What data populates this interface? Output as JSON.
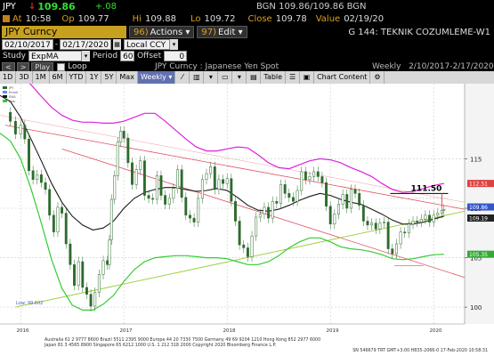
{
  "header": {
    "ticker": "JPY",
    "arrow": "↓",
    "last": "109.86",
    "change": "+.08",
    "bid_ask": "BGN 109.86/109.86 BGN",
    "at_label": "At",
    "at_value": "10:58",
    "op_label": "Op",
    "op_value": "109.77",
    "hi_label": "Hi",
    "hi_value": "109.88",
    "lo_label": "Lo",
    "lo_value": "109.72",
    "close_label": "Close",
    "close_value": "109.78",
    "value_label": "Value",
    "value_value": "02/19/20"
  },
  "function_bar": {
    "security": "JPY Curncy",
    "actions_num": "96)",
    "actions_label": "Actions",
    "edit_num": "97)",
    "edit_label": "Edit",
    "page_title": "G 144: TEKNIK COZUMLEME-W1"
  },
  "dates": {
    "start": "02/10/2017",
    "end": "02/17/2020",
    "currency": "Local CCY"
  },
  "study": {
    "label": "Study",
    "study_value": "ExpMA",
    "period_label": "Period",
    "period_value": "60",
    "offset_label": "Offset",
    "offset_value": "0"
  },
  "play": {
    "play_label": "Play",
    "loop_label": "Loop",
    "chart_name": "JPY Curncy : Japanese Yen Spot",
    "period": "Weekly",
    "range": "2/10/2017-2/17/2020"
  },
  "toolbar": {
    "tabs": [
      "1D",
      "3D",
      "1M",
      "6M",
      "YTD",
      "1Y",
      "5Y",
      "Max"
    ],
    "frequency": "Weekly",
    "table_label": "Table",
    "content_label": "Chart Content"
  },
  "chart_data": {
    "type": "line",
    "title": "",
    "x_ticks": [
      "2016",
      "2017",
      "2018",
      "2019",
      "2020"
    ],
    "y_ticks": [
      100,
      105,
      110,
      115
    ],
    "ylim": [
      98.3,
      122.6
    ],
    "xlim": [
      2015.8,
      2020.3
    ],
    "legend_items": [
      "JPY",
      "EmaU",
      "EMA",
      "Low"
    ],
    "price_tags": {
      "top": "112.51",
      "last": "109.86",
      "ema": "109.19",
      "lower": "105.35"
    },
    "annotations": {
      "target": "111.50",
      "low_label": "Low: 99.602"
    },
    "footer": [
      "Australia 61 2 9777 8600  Brazil 5511 2395 9000  Europe 44 20 7330 7500  Germany 49 69 9204 1210  Hong Kong 852 2977 6000",
      "Japan 81 3 4565 8900          Singapore 65 6212 1000          U.S. 1 212 318 2000          Copyright 2020 Bloomberg Finance L.P.",
      "SN 546679 TRT  GMT+3:00 H835-2066-0 17-Feb-2020 10:58:31"
    ],
    "price": [
      [
        2015.85,
        119.7
      ],
      [
        2015.9,
        118.8
      ],
      [
        2015.95,
        117.5
      ],
      [
        2016.0,
        118.4
      ],
      [
        2016.04,
        117.0
      ],
      [
        2016.08,
        113.8
      ],
      [
        2016.12,
        112.9
      ],
      [
        2016.16,
        113.4
      ],
      [
        2016.2,
        112.6
      ],
      [
        2016.24,
        111.9
      ],
      [
        2016.28,
        109.3
      ],
      [
        2016.32,
        107.6
      ],
      [
        2016.36,
        110.1
      ],
      [
        2016.4,
        109.5
      ],
      [
        2016.44,
        106.4
      ],
      [
        2016.48,
        104.3
      ],
      [
        2016.52,
        102.2
      ],
      [
        2016.56,
        104.6
      ],
      [
        2016.6,
        102.0
      ],
      [
        2016.64,
        101.3
      ],
      [
        2016.68,
        100.1
      ],
      [
        2016.72,
        101.5
      ],
      [
        2016.76,
        103.3
      ],
      [
        2016.8,
        104.7
      ],
      [
        2016.84,
        104.3
      ],
      [
        2016.86,
        106.8
      ],
      [
        2016.88,
        110.9
      ],
      [
        2016.91,
        113.3
      ],
      [
        2016.94,
        116.7
      ],
      [
        2016.97,
        117.8
      ],
      [
        2017.0,
        117.1
      ],
      [
        2017.04,
        114.6
      ],
      [
        2017.08,
        112.4
      ],
      [
        2017.12,
        113.9
      ],
      [
        2017.16,
        114.8
      ],
      [
        2017.2,
        111.3
      ],
      [
        2017.24,
        111.0
      ],
      [
        2017.28,
        110.9
      ],
      [
        2017.32,
        113.3
      ],
      [
        2017.36,
        111.3
      ],
      [
        2017.4,
        110.4
      ],
      [
        2017.44,
        111.0
      ],
      [
        2017.48,
        112.0
      ],
      [
        2017.52,
        113.9
      ],
      [
        2017.56,
        111.1
      ],
      [
        2017.6,
        109.3
      ],
      [
        2017.64,
        109.0
      ],
      [
        2017.68,
        108.6
      ],
      [
        2017.72,
        111.0
      ],
      [
        2017.76,
        112.9
      ],
      [
        2017.8,
        113.5
      ],
      [
        2017.84,
        114.2
      ],
      [
        2017.88,
        111.9
      ],
      [
        2017.92,
        112.9
      ],
      [
        2017.96,
        112.5
      ],
      [
        2018.0,
        113.0
      ],
      [
        2018.04,
        110.7
      ],
      [
        2018.08,
        108.7
      ],
      [
        2018.12,
        106.3
      ],
      [
        2018.16,
        106.0
      ],
      [
        2018.2,
        105.1
      ],
      [
        2018.24,
        107.2
      ],
      [
        2018.28,
        109.1
      ],
      [
        2018.32,
        109.4
      ],
      [
        2018.36,
        110.1
      ],
      [
        2018.4,
        109.0
      ],
      [
        2018.44,
        110.7
      ],
      [
        2018.48,
        110.5
      ],
      [
        2018.52,
        112.4
      ],
      [
        2018.56,
        111.5
      ],
      [
        2018.6,
        111.1
      ],
      [
        2018.64,
        110.7
      ],
      [
        2018.68,
        111.8
      ],
      [
        2018.72,
        113.7
      ],
      [
        2018.76,
        112.9
      ],
      [
        2018.8,
        113.2
      ],
      [
        2018.84,
        113.7
      ],
      [
        2018.88,
        113.2
      ],
      [
        2018.92,
        112.6
      ],
      [
        2018.96,
        110.2
      ],
      [
        2019.0,
        108.4
      ],
      [
        2019.04,
        109.4
      ],
      [
        2019.08,
        110.4
      ],
      [
        2019.12,
        111.4
      ],
      [
        2019.16,
        110.0
      ],
      [
        2019.2,
        111.9
      ],
      [
        2019.24,
        111.5
      ],
      [
        2019.28,
        110.3
      ],
      [
        2019.32,
        108.7
      ],
      [
        2019.36,
        108.3
      ],
      [
        2019.4,
        108.5
      ],
      [
        2019.44,
        107.9
      ],
      [
        2019.48,
        108.5
      ],
      [
        2019.52,
        108.6
      ],
      [
        2019.56,
        105.9
      ],
      [
        2019.6,
        105.4
      ],
      [
        2019.64,
        106.4
      ],
      [
        2019.68,
        107.6
      ],
      [
        2019.72,
        107.5
      ],
      [
        2019.76,
        108.4
      ],
      [
        2019.8,
        108.7
      ],
      [
        2019.84,
        108.6
      ],
      [
        2019.88,
        108.9
      ],
      [
        2019.92,
        109.3
      ],
      [
        2019.96,
        108.6
      ],
      [
        2020.0,
        109.3
      ],
      [
        2020.04,
        109.5
      ],
      [
        2020.08,
        109.8
      ],
      [
        2020.1,
        109.86
      ]
    ],
    "ema": [
      [
        2015.8,
        121.4
      ],
      [
        2015.9,
        120.8
      ],
      [
        2016.0,
        119.2
      ],
      [
        2016.1,
        117.0
      ],
      [
        2016.2,
        114.8
      ],
      [
        2016.3,
        112.5
      ],
      [
        2016.4,
        110.6
      ],
      [
        2016.5,
        109.2
      ],
      [
        2016.6,
        108.3
      ],
      [
        2016.7,
        107.8
      ],
      [
        2016.8,
        108.0
      ],
      [
        2016.9,
        108.7
      ],
      [
        2017.0,
        110.0
      ],
      [
        2017.1,
        111.0
      ],
      [
        2017.2,
        111.6
      ],
      [
        2017.3,
        111.9
      ],
      [
        2017.4,
        112.1
      ],
      [
        2017.5,
        112.1
      ],
      [
        2017.6,
        111.9
      ],
      [
        2017.7,
        111.7
      ],
      [
        2017.8,
        111.8
      ],
      [
        2017.9,
        112.0
      ],
      [
        2018.0,
        111.8
      ],
      [
        2018.1,
        111.1
      ],
      [
        2018.2,
        110.3
      ],
      [
        2018.3,
        109.8
      ],
      [
        2018.4,
        109.7
      ],
      [
        2018.5,
        109.9
      ],
      [
        2018.6,
        110.3
      ],
      [
        2018.7,
        110.8
      ],
      [
        2018.8,
        111.2
      ],
      [
        2018.9,
        111.5
      ],
      [
        2019.0,
        111.3
      ],
      [
        2019.1,
        110.9
      ],
      [
        2019.2,
        110.6
      ],
      [
        2019.3,
        110.4
      ],
      [
        2019.4,
        109.9
      ],
      [
        2019.5,
        109.4
      ],
      [
        2019.6,
        108.8
      ],
      [
        2019.7,
        108.4
      ],
      [
        2019.8,
        108.4
      ],
      [
        2019.9,
        108.6
      ],
      [
        2020.0,
        108.9
      ],
      [
        2020.1,
        109.19
      ]
    ],
    "upper_band": [
      [
        2015.8,
        124.4
      ],
      [
        2015.9,
        124.0
      ],
      [
        2016.0,
        123.4
      ],
      [
        2016.1,
        122.5
      ],
      [
        2016.2,
        121.3
      ],
      [
        2016.3,
        120.2
      ],
      [
        2016.4,
        119.4
      ],
      [
        2016.5,
        118.9
      ],
      [
        2016.6,
        118.7
      ],
      [
        2016.7,
        118.7
      ],
      [
        2016.8,
        118.6
      ],
      [
        2016.9,
        118.6
      ],
      [
        2017.0,
        118.8
      ],
      [
        2017.1,
        119.2
      ],
      [
        2017.2,
        119.6
      ],
      [
        2017.3,
        119.6
      ],
      [
        2017.4,
        118.8
      ],
      [
        2017.5,
        117.9
      ],
      [
        2017.6,
        117.0
      ],
      [
        2017.7,
        116.2
      ],
      [
        2017.8,
        115.8
      ],
      [
        2017.9,
        115.8
      ],
      [
        2018.0,
        116.0
      ],
      [
        2018.1,
        116.2
      ],
      [
        2018.2,
        116.1
      ],
      [
        2018.3,
        115.4
      ],
      [
        2018.4,
        114.6
      ],
      [
        2018.5,
        114.1
      ],
      [
        2018.6,
        114.0
      ],
      [
        2018.7,
        114.4
      ],
      [
        2018.8,
        114.8
      ],
      [
        2018.9,
        115.0
      ],
      [
        2019.0,
        114.9
      ],
      [
        2019.1,
        114.6
      ],
      [
        2019.2,
        114.1
      ],
      [
        2019.3,
        113.7
      ],
      [
        2019.4,
        113.2
      ],
      [
        2019.5,
        112.5
      ],
      [
        2019.6,
        111.9
      ],
      [
        2019.7,
        111.6
      ],
      [
        2019.8,
        111.7
      ],
      [
        2019.9,
        112.0
      ],
      [
        2020.0,
        112.3
      ],
      [
        2020.1,
        112.51
      ]
    ],
    "lower_band": [
      [
        2015.8,
        117.6
      ],
      [
        2015.9,
        116.8
      ],
      [
        2016.0,
        115.0
      ],
      [
        2016.1,
        112.0
      ],
      [
        2016.2,
        108.5
      ],
      [
        2016.3,
        104.8
      ],
      [
        2016.4,
        101.9
      ],
      [
        2016.5,
        100.2
      ],
      [
        2016.6,
        99.7
      ],
      [
        2016.7,
        99.7
      ],
      [
        2016.8,
        100.3
      ],
      [
        2016.9,
        101.2
      ],
      [
        2017.0,
        102.6
      ],
      [
        2017.1,
        103.8
      ],
      [
        2017.2,
        104.6
      ],
      [
        2017.3,
        105.0
      ],
      [
        2017.4,
        105.1
      ],
      [
        2017.5,
        105.2
      ],
      [
        2017.6,
        105.2
      ],
      [
        2017.7,
        105.1
      ],
      [
        2017.8,
        105.0
      ],
      [
        2017.9,
        105.0
      ],
      [
        2018.0,
        104.9
      ],
      [
        2018.1,
        104.6
      ],
      [
        2018.2,
        104.3
      ],
      [
        2018.3,
        104.3
      ],
      [
        2018.4,
        104.6
      ],
      [
        2018.5,
        105.2
      ],
      [
        2018.6,
        106.0
      ],
      [
        2018.7,
        106.6
      ],
      [
        2018.8,
        107.0
      ],
      [
        2018.9,
        107.0
      ],
      [
        2019.0,
        106.6
      ],
      [
        2019.1,
        106.1
      ],
      [
        2019.2,
        105.9
      ],
      [
        2019.3,
        105.8
      ],
      [
        2019.4,
        105.6
      ],
      [
        2019.5,
        105.3
      ],
      [
        2019.6,
        104.9
      ],
      [
        2019.7,
        104.8
      ],
      [
        2019.8,
        104.9
      ],
      [
        2019.9,
        105.1
      ],
      [
        2020.0,
        105.3
      ],
      [
        2020.1,
        105.35
      ]
    ]
  },
  "colors": {
    "price": "#2e6b2e",
    "ema": "#1a1a1a",
    "upper": "#dd22dd",
    "lower": "#33cc33",
    "trend_red": "#e05060",
    "trend_green": "#99cc33",
    "tag_red": "#e04040",
    "tag_blue": "#3355cc",
    "tag_green": "#33aa33"
  }
}
